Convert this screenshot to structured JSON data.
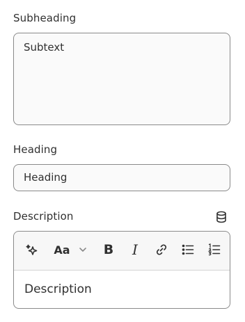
{
  "subheading": {
    "label": "Subheading",
    "value": "Subtext"
  },
  "heading": {
    "label": "Heading",
    "value": "Heading"
  },
  "description": {
    "label": "Description",
    "value": "Description",
    "dynamic_source_icon": "database-icon",
    "toolbar": [
      {
        "name": "ai-sparkle-icon"
      },
      {
        "name": "text-style-icon",
        "label": "Aa"
      },
      {
        "name": "chevron-down-icon"
      },
      {
        "name": "bold-icon",
        "label": "B"
      },
      {
        "name": "italic-icon",
        "label": "I"
      },
      {
        "name": "link-icon"
      },
      {
        "name": "bullet-list-icon"
      },
      {
        "name": "numbered-list-icon"
      }
    ]
  }
}
